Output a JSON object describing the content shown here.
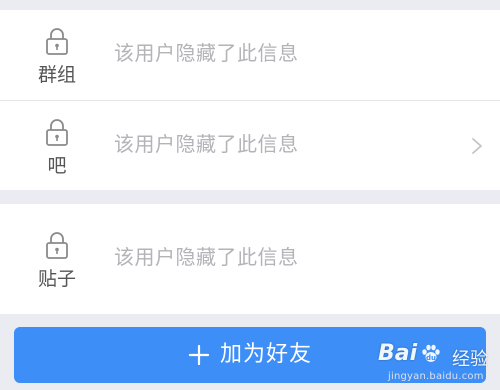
{
  "profile_sections": [
    {
      "title": "群组",
      "value": "该用户隐藏了此信息",
      "icon": "lock-icon",
      "has_chevron": false
    },
    {
      "title": "吧",
      "value": "该用户隐藏了此信息",
      "icon": "lock-icon",
      "has_chevron": true
    },
    {
      "title": "贴子",
      "value": "该用户隐藏了此信息",
      "icon": "lock-icon",
      "has_chevron": false
    }
  ],
  "action_button": {
    "label": "加为好友",
    "icon": "plus-icon",
    "color": "#3d8ef7"
  },
  "watermark": {
    "logo_text": "Bai",
    "brand_text": "经验",
    "url": "jingyan.baidu.com"
  },
  "colors": {
    "background": "#ebecf1",
    "card": "#ffffff",
    "title_text": "#555555",
    "hidden_text": "#b3b3b8",
    "button": "#3d8ef7"
  }
}
